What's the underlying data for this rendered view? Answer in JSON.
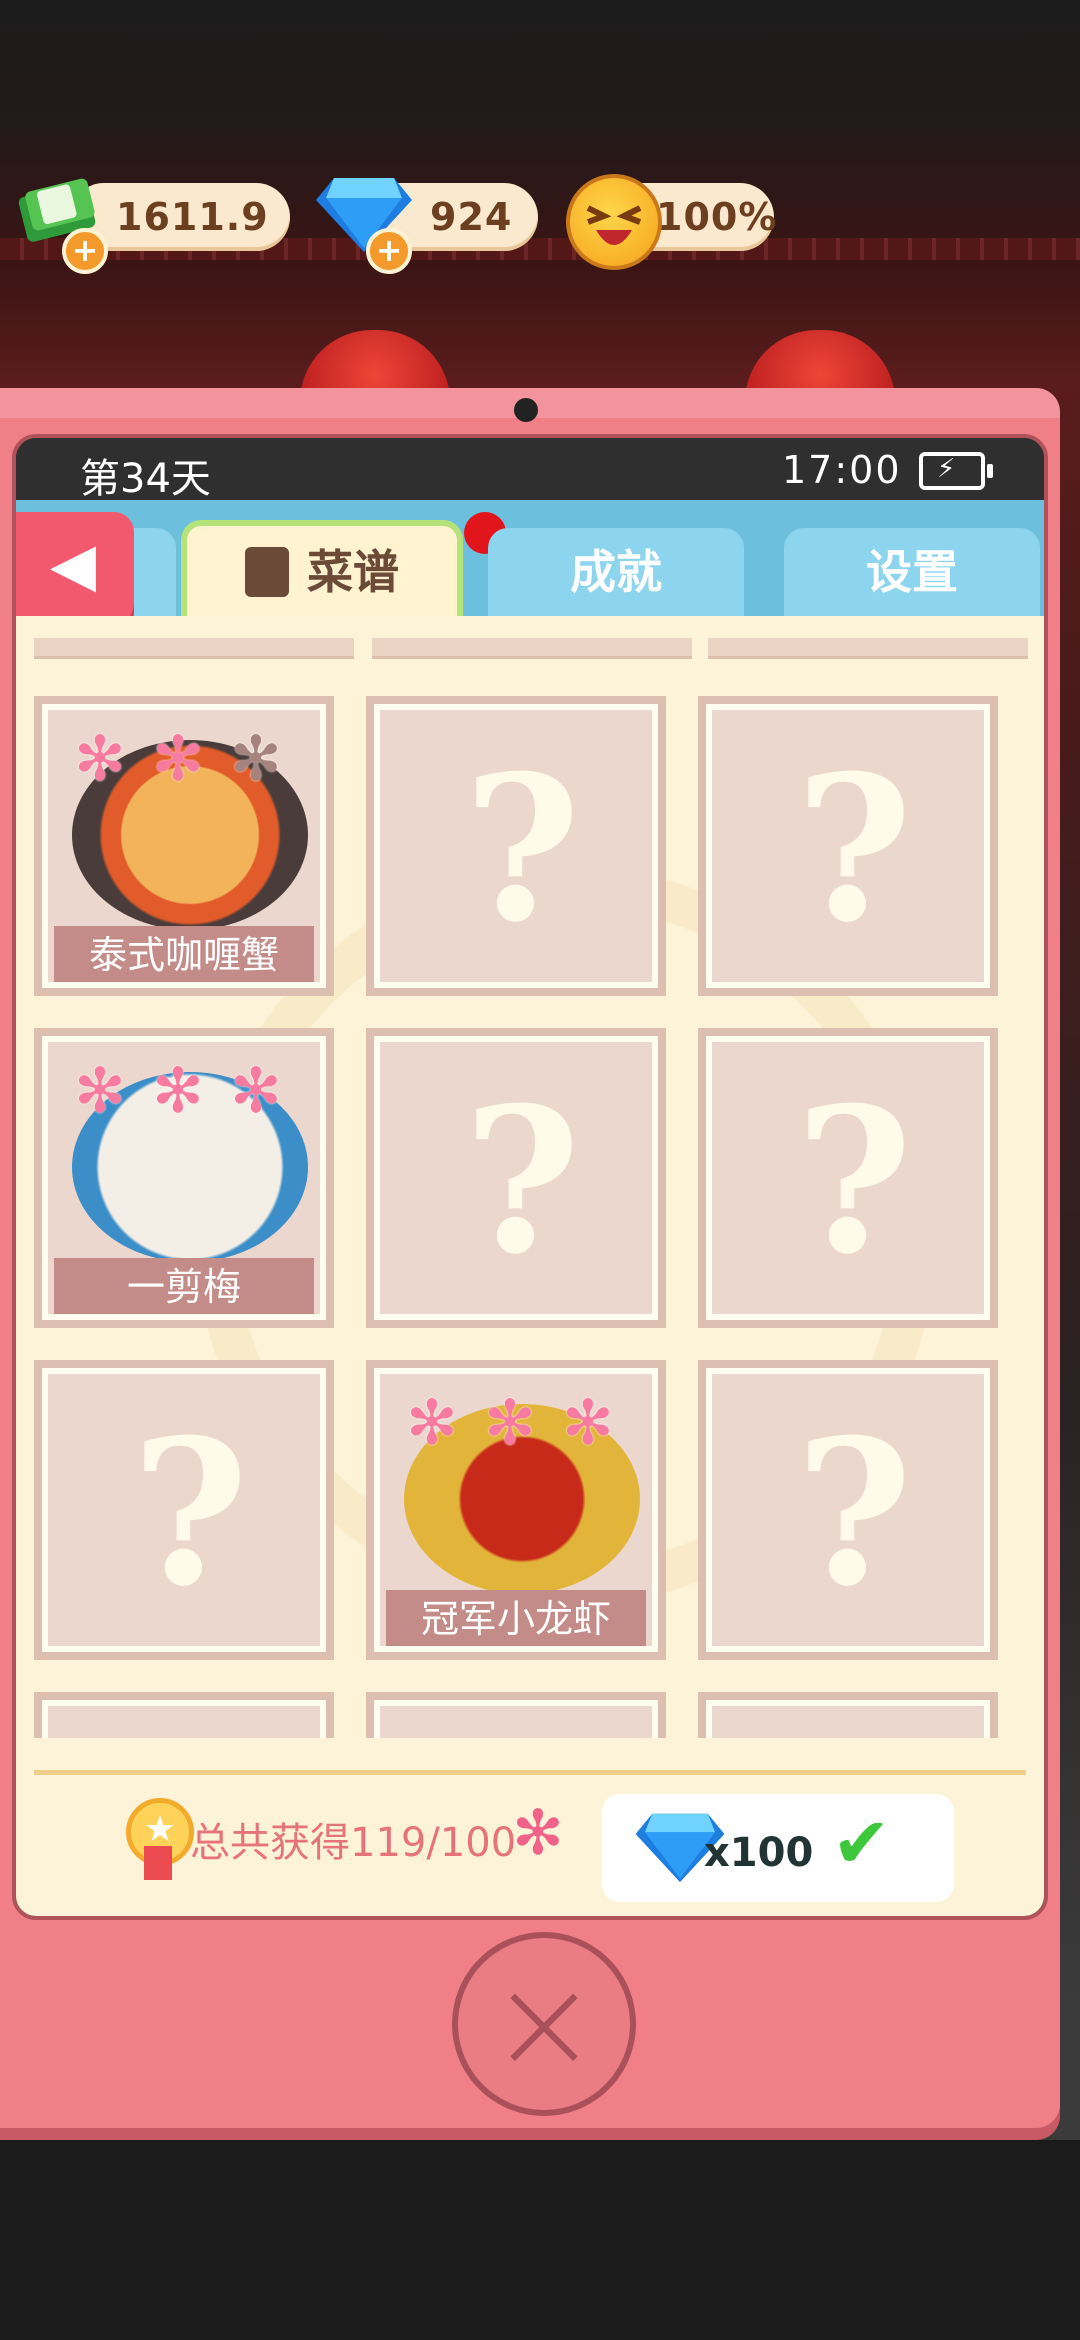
{
  "resources": {
    "cash": "1611.9",
    "gems": "924",
    "happiness": "100%"
  },
  "status_bar": {
    "day": "第34天",
    "time": "17:00"
  },
  "tabs": [
    {
      "label": "菜谱",
      "active": true
    },
    {
      "label": "成就",
      "active": false
    },
    {
      "label": "设置",
      "active": false
    }
  ],
  "recipes": [
    {
      "name": "泰式咖喱蟹",
      "unlocked": true,
      "stars": 2
    },
    {
      "name": "",
      "unlocked": false
    },
    {
      "name": "",
      "unlocked": false
    },
    {
      "name": "一剪梅",
      "unlocked": true,
      "stars": 3
    },
    {
      "name": "",
      "unlocked": false
    },
    {
      "name": "",
      "unlocked": false
    },
    {
      "name": "",
      "unlocked": false
    },
    {
      "name": "冠军小龙虾",
      "unlocked": true,
      "stars": 3
    },
    {
      "name": "",
      "unlocked": false
    }
  ],
  "locked_symbol": "?",
  "footer": {
    "total_text": "总共获得119/100",
    "reward_count": "x100"
  },
  "colors": {
    "frame": "#f07f88",
    "tab_blue": "#8dd4ee",
    "flower_pink": "#f77aa0",
    "locked_card": "#ecd7ce"
  }
}
